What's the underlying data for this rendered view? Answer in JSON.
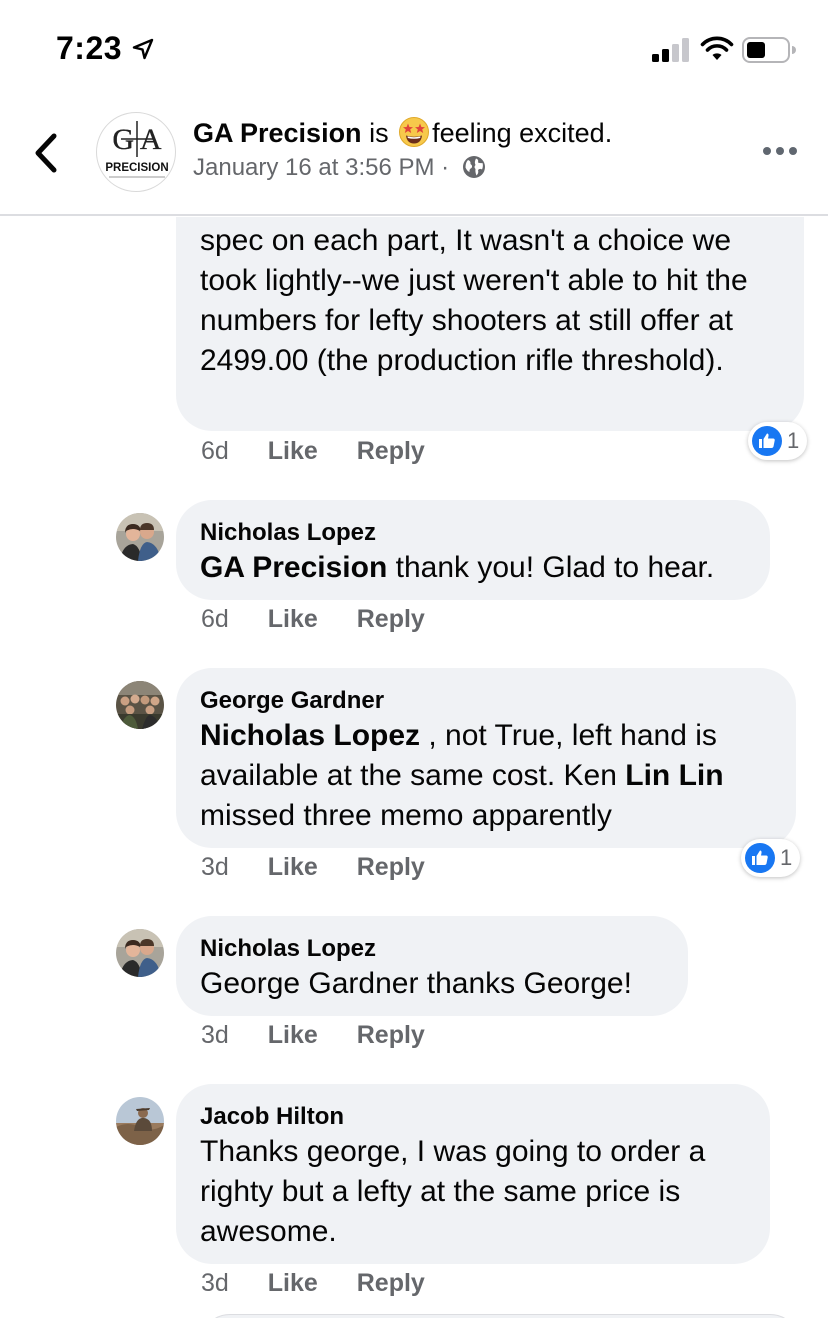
{
  "status_bar": {
    "time": "7:23"
  },
  "header": {
    "page_name": "GA Precision",
    "is_text": " is ",
    "feeling_text": "feeling excited.",
    "logo_text_top": "G A",
    "logo_text_bottom": "PRECISION",
    "date": "January 16 at 3:56 PM",
    "separator": " · "
  },
  "comments": [
    {
      "author": "",
      "text": "spec on each part, It wasn't a choice we took lightly--we just weren't able to hit the numbers for lefty shooters at still offer at 2499.00 (the production rifle threshold).",
      "time": "6d",
      "like": "Like",
      "reply": "Reply",
      "reactions": "1"
    },
    {
      "author": "Nicholas Lopez",
      "mention": "GA Precision",
      "text": " thank you! Glad to hear.",
      "time": "6d",
      "like": "Like",
      "reply": "Reply"
    },
    {
      "author": "George Gardner",
      "mention": "Nicholas Lopez",
      "text_1": " , not True, left hand is available at the same cost.   Ken ",
      "mention_2": "Lin Lin",
      "text_2": " missed three memo apparently",
      "time": "3d",
      "like": "Like",
      "reply": "Reply",
      "reactions": "1"
    },
    {
      "author": "Nicholas Lopez",
      "text": "George Gardner thanks George!",
      "time": "3d",
      "like": "Like",
      "reply": "Reply"
    },
    {
      "author": "Jacob Hilton",
      "text": "Thanks george, I was going to order a righty but a lefty at the same price is awesome.",
      "time": "3d",
      "like": "Like",
      "reply": "Reply"
    }
  ],
  "colors": {
    "bubble": "#f0f2f5",
    "secondary_text": "#65676b",
    "like_blue": "#1877f2"
  }
}
